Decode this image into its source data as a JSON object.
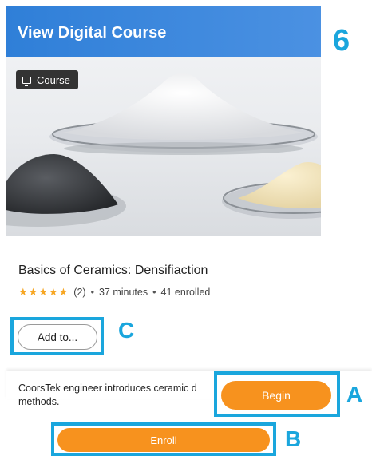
{
  "hero": {
    "title": "View Digital Course",
    "badge_icon": "presentation-icon",
    "badge_label": "Course"
  },
  "step_number": "6",
  "course": {
    "title": "Basics of Ceramics: Densifiaction",
    "rating_stars": "★★★★★",
    "rating_count": "(2)",
    "duration": "37 minutes",
    "enrolled": "41 enrolled",
    "separator": "•"
  },
  "actions": {
    "add_to_label": "Add to...",
    "begin_label": "Begin",
    "enroll_label": "Enroll"
  },
  "description": "CoorsTek engineer introduces ceramic d methods.",
  "callouts": {
    "a": "A",
    "b": "B",
    "c": "C"
  },
  "colors": {
    "header_blue": "#3a86dc",
    "callout_blue": "#1aa6dd",
    "button_orange": "#f7921e",
    "star_orange": "#f6a623"
  }
}
